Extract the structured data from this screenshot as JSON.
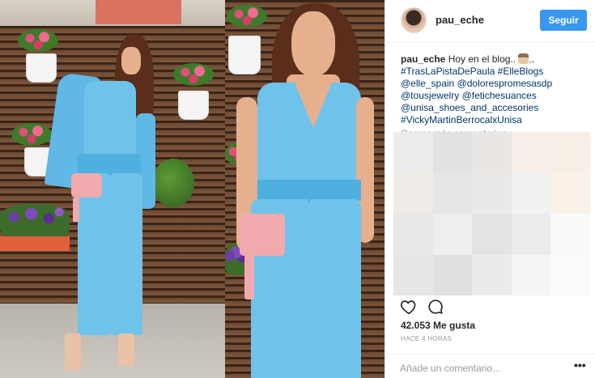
{
  "header": {
    "username": "pau_eche",
    "follow_label": "Seguir"
  },
  "caption": {
    "username": "pau_eche",
    "line1_text": " Hoy en el blog..",
    "line1_tail": "..",
    "line2_tag1": "#TrasLaPistaDePaula",
    "line2_tag2": "#ElleBlogs",
    "line3_tag1": "@elle_spain",
    "line3_tag2": "@dolorespromesasdp",
    "line4_tag1": "@tousjewelry",
    "line4_tag2": "@fetichesuances",
    "line5_tag1": "@unisa_shoes_and_accesories",
    "line6_tag1": "#VickyMartinBerrocalxUnisa"
  },
  "more_comments": "Cargar más comentarios",
  "mosaic_colors": [
    "#ececec",
    "#e2e2e2",
    "#e9e6e3",
    "#f5efe8",
    "#f7efe6",
    "#efebe6",
    "#e6e6e6",
    "#e9e9e9",
    "#f1f1f1",
    "#f7f1e8",
    "#e8e8e8",
    "#eeeeee",
    "#e4e4e4",
    "#ececec",
    "#f9f9f9",
    "#e6e6e6",
    "#e0e0e0",
    "#ebebeb",
    "#f4f4f4",
    "#fbfbfb"
  ],
  "actions": {
    "like_icon": "heart-icon",
    "comment_icon": "comment-icon"
  },
  "likes_text": "42.053 Me gusta",
  "timestamp": "HACE 4 HORAS",
  "comment_placeholder": "Añade un comentario...",
  "options_label": "•••",
  "colors": {
    "follow_button": "#3897f0",
    "hashtag": "#003569",
    "jumpsuit": "#6fc3ea"
  }
}
